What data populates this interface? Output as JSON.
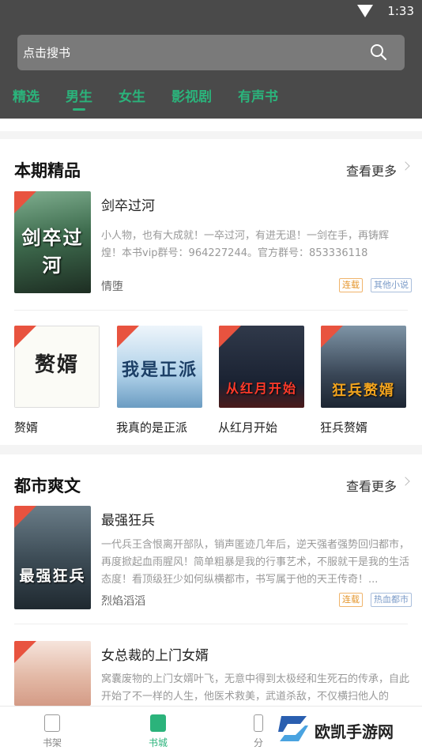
{
  "status": {
    "time": "1:33"
  },
  "search": {
    "placeholder": "点击搜书"
  },
  "tabs": [
    {
      "label": "精选"
    },
    {
      "label": "男生"
    },
    {
      "label": "女生"
    },
    {
      "label": "影视剧"
    },
    {
      "label": "有声书"
    }
  ],
  "sections": [
    {
      "title": "本期精品",
      "more": "查看更多",
      "featured": {
        "title": "剑卒过河",
        "cover_text": "剑卒过河",
        "desc": "小人物，也有大成就！一卒过河，有进无退！一剑在手，再铸辉煌！本书vip群号：964227244。官方群号：853336118",
        "author": "情堕",
        "tags": [
          "连载",
          "其他小说"
        ]
      },
      "grid": [
        {
          "title": "赘婿",
          "cover_text": "赘婿"
        },
        {
          "title": "我真的是正派",
          "cover_text": "我是正派"
        },
        {
          "title": "从红月开始",
          "cover_text": "从红月开始"
        },
        {
          "title": "狂兵赘婿",
          "cover_text": "狂兵赘婿"
        }
      ]
    },
    {
      "title": "都市爽文",
      "more": "查看更多",
      "items": [
        {
          "title": "最强狂兵",
          "cover_text": "最强狂兵",
          "desc": "一代兵王含恨离开部队，销声匿迹几年后，逆天强者强势回归都市，再度掀起血雨腥风！简单粗暴是我的行事艺术，不服就干是我的生活态度！看顶级狂少如何纵横都市，书写属于他的天王传奇！...",
          "author": "烈焰滔滔",
          "tags": [
            "连载",
            "热血都市"
          ]
        },
        {
          "title": "女总裁的上门女婿",
          "cover_text": "",
          "desc": "窝囊废物的上门女婿叶飞，无意中得到太极经和生死石的传承，自此开始了不一样的人生，他医术救美，武道杀敌，不仅横扫他人的"
        }
      ]
    }
  ],
  "bottom_nav": [
    {
      "label": "书架",
      "icon": "bookshelf-icon"
    },
    {
      "label": "书城",
      "icon": "bookstore-icon"
    },
    {
      "label": "分",
      "icon": "category-icon"
    }
  ],
  "watermark": {
    "text": "欧凯手游网"
  },
  "colors": {
    "accent": "#2bb37b",
    "header_bg": "#4a4a4a",
    "free_badge": "#e8533f"
  }
}
